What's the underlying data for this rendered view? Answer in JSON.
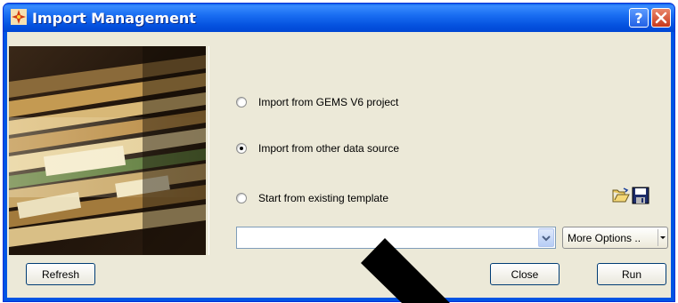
{
  "window": {
    "title": "Import Management",
    "colors": {
      "titlebar": "#0054e3",
      "client": "#ece9d8"
    }
  },
  "titlebar_buttons": {
    "help_glyph": "?",
    "close_glyph": "✕"
  },
  "options": [
    {
      "label": "Import from GEMS V6 project",
      "checked": false
    },
    {
      "label": "Import from other data source",
      "checked": true
    },
    {
      "label": "Start from existing template",
      "checked": false
    }
  ],
  "template_select": {
    "value": ""
  },
  "more_options_label": "More Options ..",
  "buttons": {
    "refresh": "Refresh",
    "close": "Close",
    "run": "Run"
  },
  "icons": [
    "app-icon",
    "help-icon",
    "close-icon",
    "open-folder-icon",
    "save-icon",
    "dropdown-arrow-icon"
  ]
}
